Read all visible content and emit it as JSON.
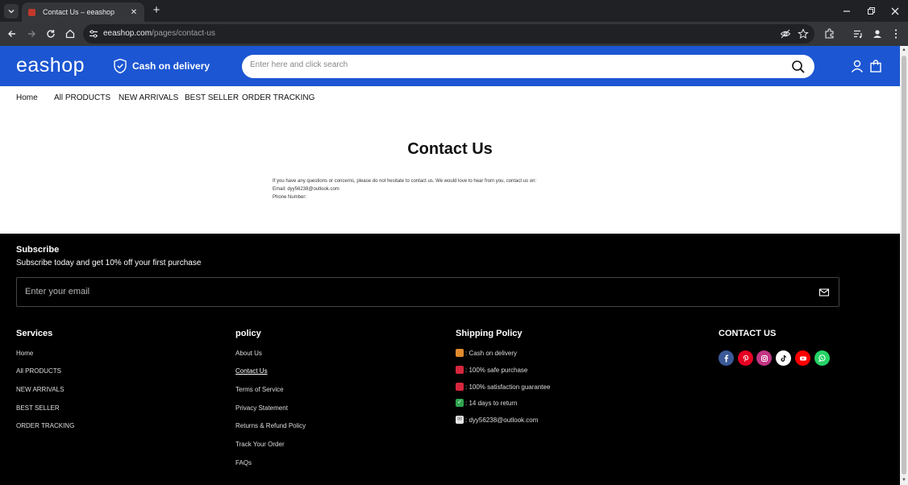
{
  "browser": {
    "tab_title": "Contact Us – eeashop",
    "url_host": "eeashop.com",
    "url_path": "/pages/contact-us"
  },
  "header": {
    "logo": "eashop",
    "cod_label": "Cash on delivery",
    "search_placeholder": "Enter here and click search",
    "colors": {
      "brand": "#1c56d2"
    }
  },
  "nav": {
    "items": [
      "Home",
      "All PRODUCTS",
      "NEW ARRIVALS",
      "BEST SELLER",
      "ORDER TRACKING"
    ]
  },
  "content": {
    "title": "Contact Us",
    "line1": "If you have any questions or concerns, please do not hesitate to contact us. We would love to hear from you, contact us on:",
    "line2": "Email: dyy56238@outlook.com",
    "line3": "Phone Number:"
  },
  "footer": {
    "subscribe_title": "Subscribe",
    "subscribe_text": "Subscribe today and get 10% off your first purchase",
    "email_placeholder": "Enter your email",
    "services": {
      "title": "Services",
      "links": [
        "Home",
        "All PRODUCTS",
        "NEW ARRIVALS",
        "BEST SELLER",
        "ORDER TRACKING"
      ]
    },
    "policy": {
      "title": "policy",
      "links": [
        "About Us",
        "Contact Us",
        "Terms of Service",
        "Privacy Statement",
        "Returns & Refund Policy",
        "Track Your Order",
        "FAQs"
      ]
    },
    "shipping": {
      "title": "Shipping Policy",
      "items": [
        ": Cash on delivery",
        ": 100% safe purchase",
        ": 100% satisfaction guarantee",
        ": 14 days to return",
        ": dyy56238@outlook.com"
      ]
    },
    "contact": {
      "title": "CONTACT US",
      "social": [
        "facebook-icon",
        "pinterest-icon",
        "instagram-icon",
        "tiktok-icon",
        "youtube-icon",
        "whatsapp-icon"
      ]
    }
  }
}
